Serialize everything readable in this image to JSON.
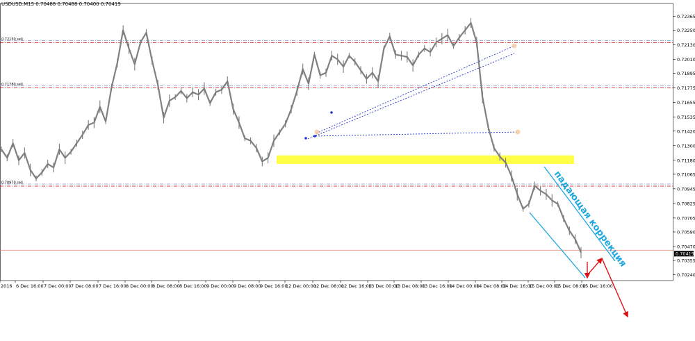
{
  "chart_data": {
    "type": "line",
    "symbol": "USDUSD.M15",
    "header": "USDUSD.M15  0.70488 0.70488 0.70400 0.70419",
    "x_ticks": [
      "2016",
      "6 Dec 16:00",
      "7 Dec 00:00",
      "7 Dec 08:00",
      "7 Dec 16:00",
      "8 Dec 00:00",
      "8 Dec 08:00",
      "8 Dec 16:00",
      "9 Dec 00:00",
      "9 Dec 08:00",
      "9 Dec 16:00",
      "12 Dec 00:00",
      "12 Dec 08:00",
      "12 Dec 16:00",
      "13 Dec 00:00",
      "13 Dec 08:00",
      "13 Dec 16:00",
      "14 Dec 00:00",
      "14 Dec 08:00",
      "14 Dec 16:00",
      "15 Dec 00:00",
      "15 Dec 08:00",
      "15 Dec 16:00"
    ],
    "y_ticks": [
      "0.72365",
      "0.72250",
      "0.72130",
      "0.72010",
      "0.71895",
      "0.71775",
      "0.71655",
      "0.71535",
      "0.71420",
      "0.71300",
      "0.71180",
      "0.71065",
      "0.70945",
      "0.70825",
      "0.70705",
      "0.70590",
      "0.70470",
      "0.70355",
      "0.70240"
    ],
    "ylim": [
      0.7019,
      0.7247
    ],
    "current_price": "0.70419",
    "grid": false,
    "levels": [
      {
        "price": 0.7215,
        "label": "0.72150 sell",
        "color": "#cc0000"
      },
      {
        "price": 0.7178,
        "label": "0.71780 sell",
        "color": "#cc0000"
      },
      {
        "price": 0.7097,
        "label": "0.70970 sell",
        "color": "#cc0000"
      },
      {
        "price": 0.7044,
        "label": "",
        "color": "#f08070"
      }
    ],
    "support_zone": {
      "price_top": 0.7122,
      "price_bottom": 0.7115,
      "color": "#ffff33"
    },
    "annotation": "падающая коррекция",
    "price_series": [
      0.7127,
      0.712,
      0.7132,
      0.7118,
      0.7124,
      0.711,
      0.7103,
      0.7108,
      0.7115,
      0.7112,
      0.7127,
      0.712,
      0.7125,
      0.7132,
      0.7139,
      0.7147,
      0.7149,
      0.7162,
      0.715,
      0.7178,
      0.7198,
      0.7225,
      0.721,
      0.7197,
      0.7215,
      0.7223,
      0.72,
      0.718,
      0.7153,
      0.7167,
      0.717,
      0.7175,
      0.7169,
      0.7174,
      0.7172,
      0.7177,
      0.7165,
      0.7174,
      0.7176,
      0.7183,
      0.716,
      0.7149,
      0.7136,
      0.7134,
      0.7128,
      0.7117,
      0.712,
      0.7134,
      0.7141,
      0.7148,
      0.716,
      0.7175,
      0.7193,
      0.7181,
      0.7205,
      0.7188,
      0.719,
      0.7204,
      0.7201,
      0.7195,
      0.7204,
      0.7199,
      0.7192,
      0.7185,
      0.719,
      0.7183,
      0.721,
      0.722,
      0.7205,
      0.7204,
      0.7203,
      0.7196,
      0.7205,
      0.721,
      0.7207,
      0.7215,
      0.7218,
      0.7221,
      0.7212,
      0.7219,
      0.7225,
      0.7231,
      0.7215,
      0.717,
      0.7145,
      0.7128,
      0.7121,
      0.7116,
      0.7105,
      0.709,
      0.7078,
      0.7082,
      0.7097,
      0.7093,
      0.709,
      0.7085,
      0.7082,
      0.707,
      0.706,
      0.7053,
      0.7042
    ]
  }
}
